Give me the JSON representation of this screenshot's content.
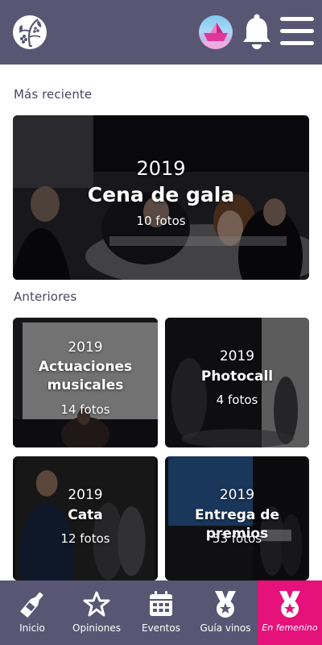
{
  "header": {
    "logo_icon": "grape-vine-logo-icon",
    "avatar_icon": "paper-boat-avatar-icon",
    "notification_icon": "bell-icon",
    "menu_icon": "hamburger-menu-icon",
    "background_color": "#585673"
  },
  "sections": {
    "recent_title": "Más reciente",
    "previous_title": "Anteriores"
  },
  "featured": {
    "year": "2019",
    "title": "Cena de gala",
    "count": "10 fotos"
  },
  "albums": [
    {
      "year": "2019",
      "title": "Actuaciones musicales",
      "count": "14 fotos"
    },
    {
      "year": "2019",
      "title": "Photocall",
      "count": "4 fotos"
    },
    {
      "year": "2019",
      "title": "Cata",
      "count": "12 fotos"
    },
    {
      "year": "2019",
      "title": "Entrega de premios",
      "count": "53 fotos"
    }
  ],
  "bottom_nav": {
    "items": [
      {
        "label": "Inicio",
        "icon": "wine-bottle-icon"
      },
      {
        "label": "Opiniones",
        "icon": "star-icon"
      },
      {
        "label": "Eventos",
        "icon": "calendar-icon"
      },
      {
        "label": "Guía vinos",
        "icon": "medal-icon"
      },
      {
        "label": "En femenino",
        "icon": "medal-icon"
      }
    ],
    "active_index": 4,
    "active_color": "#e4127a"
  }
}
